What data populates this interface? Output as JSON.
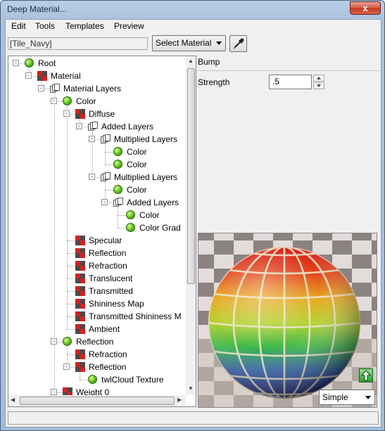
{
  "window": {
    "title": "Deep Material...",
    "close_label": "x"
  },
  "menu": [
    "Edit",
    "Tools",
    "Templates",
    "Preview"
  ],
  "toolbar": {
    "material_name": "[Tile_Navy]",
    "select_label": "Select Material"
  },
  "tree": {
    "nodes": [
      {
        "label": "Root",
        "icon": "ball-icon"
      },
      {
        "label": "Material",
        "icon": "material-icon"
      },
      {
        "label": "Material Layers",
        "icon": "layers-icon"
      },
      {
        "label": "Color",
        "icon": "ball-icon"
      },
      {
        "label": "Diffuse",
        "icon": "material-icon"
      },
      {
        "label": "Added Layers",
        "icon": "layers-icon"
      },
      {
        "label": "Multiplied Layers",
        "icon": "layers-icon"
      },
      {
        "label": "Color",
        "icon": "ball-icon"
      },
      {
        "label": "Color",
        "icon": "ball-icon"
      },
      {
        "label": "Multiplied Layers",
        "icon": "layers-icon"
      },
      {
        "label": "Color",
        "icon": "ball-icon"
      },
      {
        "label": "Added Layers",
        "icon": "layers-icon"
      },
      {
        "label": "Color",
        "icon": "ball-icon"
      },
      {
        "label": "Color Grad",
        "icon": "ball-icon"
      },
      {
        "label": "Specular",
        "icon": "material-icon"
      },
      {
        "label": "Reflection",
        "icon": "material-icon"
      },
      {
        "label": "Refraction",
        "icon": "material-icon"
      },
      {
        "label": "Translucent",
        "icon": "material-icon"
      },
      {
        "label": "Transmitted",
        "icon": "material-icon"
      },
      {
        "label": "Shininess Map",
        "icon": "material-icon"
      },
      {
        "label": "Transmitted Shininess M",
        "icon": "material-icon"
      },
      {
        "label": "Ambient",
        "icon": "material-icon"
      },
      {
        "label": "Reflection",
        "icon": "ball-icon"
      },
      {
        "label": "Refraction",
        "icon": "material-icon"
      },
      {
        "label": "Reflection",
        "icon": "material-icon"
      },
      {
        "label": "twlCloud Texture",
        "icon": "ball-icon"
      },
      {
        "label": "Weight 0",
        "icon": "material-icon"
      }
    ]
  },
  "properties": {
    "section_title": "Bump",
    "strength_label": "Strength",
    "strength_value": ".5"
  },
  "preview": {
    "mode": "Simple"
  }
}
